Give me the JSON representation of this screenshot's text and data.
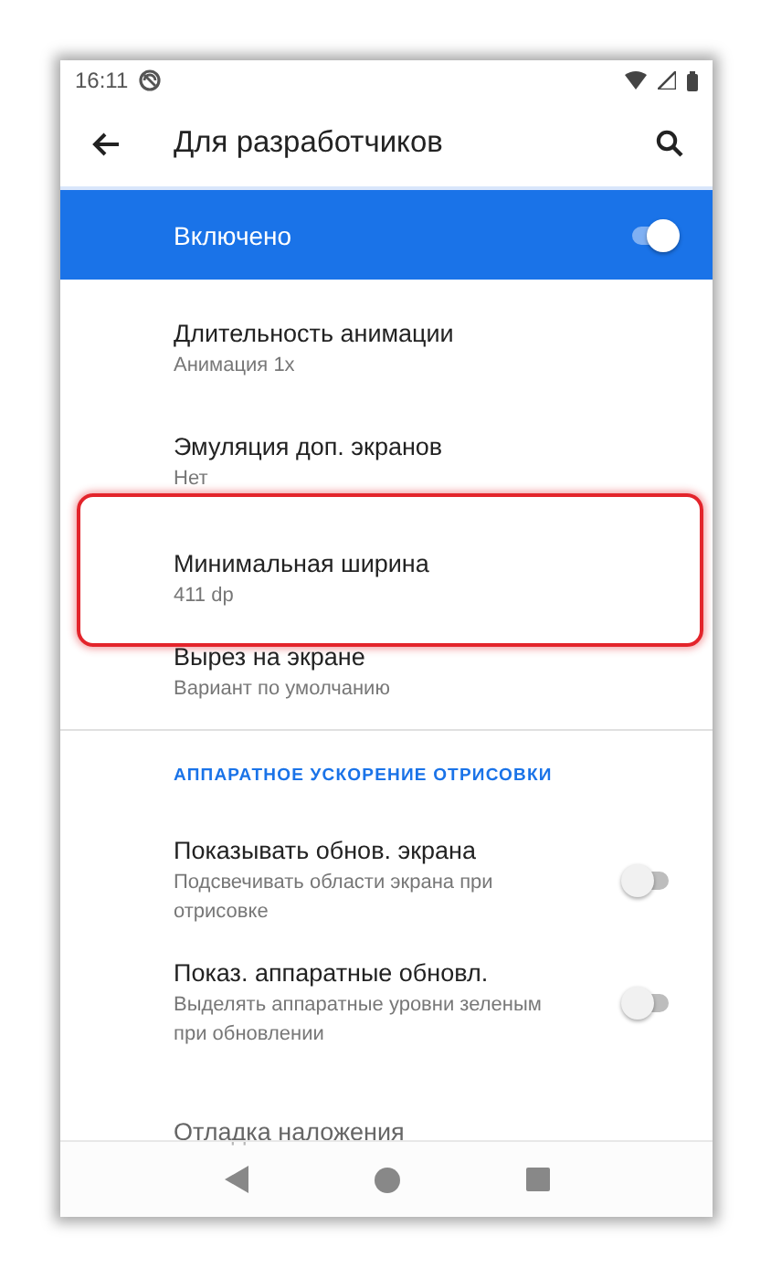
{
  "status_bar": {
    "time": "16:11"
  },
  "app_bar": {
    "title": "Для разработчиков"
  },
  "master_switch": {
    "label": "Включено",
    "on": true
  },
  "items": [
    {
      "kind": "plain",
      "title": "Длительность анимации",
      "subtitle": "Анимация 1x",
      "highlighted": false
    },
    {
      "kind": "plain",
      "title": "Эмуляция доп. экранов",
      "subtitle": "Нет",
      "highlighted": false
    },
    {
      "kind": "plain",
      "title": "Минимальная ширина",
      "subtitle": "411 dp",
      "highlighted": true
    },
    {
      "kind": "plain",
      "title": "Вырез на экране",
      "subtitle": "Вариант по умолчанию",
      "highlighted": false
    },
    {
      "kind": "header",
      "title": "АППАРАТНОЕ УСКОРЕНИЕ ОТРИСОВКИ"
    },
    {
      "kind": "switch",
      "title": "Показывать обнов. экрана",
      "subtitle": "Подсвечивать области экрана при отрисовке",
      "on": false
    },
    {
      "kind": "switch",
      "title": "Показ. аппаратные обновл.",
      "subtitle": "Выделять аппаратные уровни зеленым при обновлении",
      "on": false
    },
    {
      "kind": "plain",
      "title": "Отладка наложения",
      "highlighted": false
    }
  ]
}
